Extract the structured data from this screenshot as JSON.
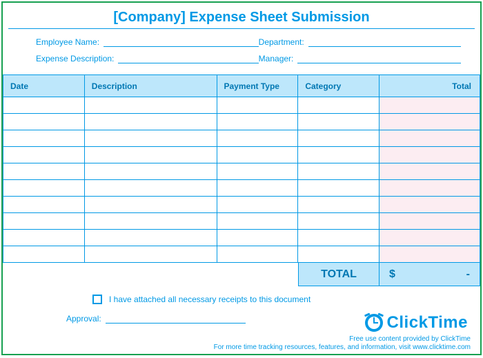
{
  "title": "[Company] Expense Sheet Submission",
  "info": {
    "employee_name_label": "Employee Name:",
    "department_label": "Department:",
    "expense_desc_label": "Expense Description:",
    "manager_label": "Manager:"
  },
  "columns": {
    "date": "Date",
    "description": "Description",
    "payment_type": "Payment Type",
    "category": "Category",
    "total": "Total"
  },
  "rows": [
    {
      "date": "",
      "description": "",
      "payment_type": "",
      "category": "",
      "total": ""
    },
    {
      "date": "",
      "description": "",
      "payment_type": "",
      "category": "",
      "total": ""
    },
    {
      "date": "",
      "description": "",
      "payment_type": "",
      "category": "",
      "total": ""
    },
    {
      "date": "",
      "description": "",
      "payment_type": "",
      "category": "",
      "total": ""
    },
    {
      "date": "",
      "description": "",
      "payment_type": "",
      "category": "",
      "total": ""
    },
    {
      "date": "",
      "description": "",
      "payment_type": "",
      "category": "",
      "total": ""
    },
    {
      "date": "",
      "description": "",
      "payment_type": "",
      "category": "",
      "total": ""
    },
    {
      "date": "",
      "description": "",
      "payment_type": "",
      "category": "",
      "total": ""
    },
    {
      "date": "",
      "description": "",
      "payment_type": "",
      "category": "",
      "total": ""
    },
    {
      "date": "",
      "description": "",
      "payment_type": "",
      "category": "",
      "total": ""
    }
  ],
  "footer": {
    "total_label": "TOTAL",
    "currency": "$",
    "dash": "-"
  },
  "attach": {
    "text": "I have attached all necessary receipts to this document"
  },
  "approval_label": "Approval:",
  "brand": "ClickTime",
  "credit1": "Free use content provided by ClickTime",
  "credit2": "For more time tracking resources, features, and information, visit www.clicktime.com"
}
